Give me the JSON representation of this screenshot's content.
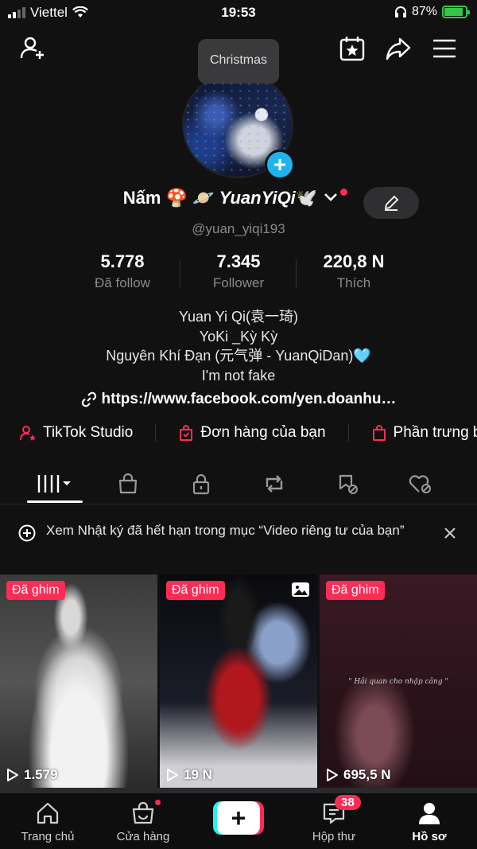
{
  "status_bar": {
    "carrier": "Viettel",
    "time": "19:53",
    "battery": "87%",
    "battery_level": 0.87
  },
  "tooltip": "Christmas",
  "profile": {
    "name_prefix": "Nấm 🍄 🪐",
    "name_italic": "YuanYiQi",
    "name_suffix": "🕊️",
    "handle": "@yuan_yiqi193"
  },
  "stats": [
    {
      "value": "5.778",
      "label": "Đã follow"
    },
    {
      "value": "7.345",
      "label": "Follower"
    },
    {
      "value": "220,8 N",
      "label": "Thích"
    }
  ],
  "bio": [
    "Yuan Yi Qi(袁一琦)",
    "YoKi _Kỳ Kỳ",
    "Nguyên Khí Đạn (元气弹 - YuanQiDan)🩵",
    "I'm not fake"
  ],
  "link": "https://www.facebook.com/yen.doanhu…",
  "shortcuts": [
    "TikTok Studio",
    "Đơn hàng của bạn",
    "Phần trưng bày"
  ],
  "tabs": [
    "videos-icon",
    "shop-icon",
    "lock-icon",
    "repost-icon",
    "saved-icon",
    "liked-icon"
  ],
  "notice": "Xem Nhật ký đã hết hạn trong mục “Video riêng tư của bạn”",
  "videos": [
    {
      "pin": "Đã ghim",
      "views": "1.579"
    },
    {
      "pin": "Đã ghim",
      "views": "19 N"
    },
    {
      "pin": "Đã ghim",
      "views": "695,5 N",
      "quote": "\" Hải quan cho nhập cảng \""
    }
  ],
  "bottom_nav": [
    {
      "label": "Trang chủ",
      "icon": "home-icon"
    },
    {
      "label": "Cửa hàng",
      "icon": "shop-bag-icon"
    },
    {
      "label": "",
      "icon": "create-plus-icon"
    },
    {
      "label": "Hộp thư",
      "icon": "inbox-icon",
      "badge": "38"
    },
    {
      "label": "Hồ sơ",
      "icon": "profile-icon"
    }
  ],
  "colors": {
    "accent": "#fe2c55",
    "cyan": "#25f4ee",
    "battery": "#39c449"
  }
}
